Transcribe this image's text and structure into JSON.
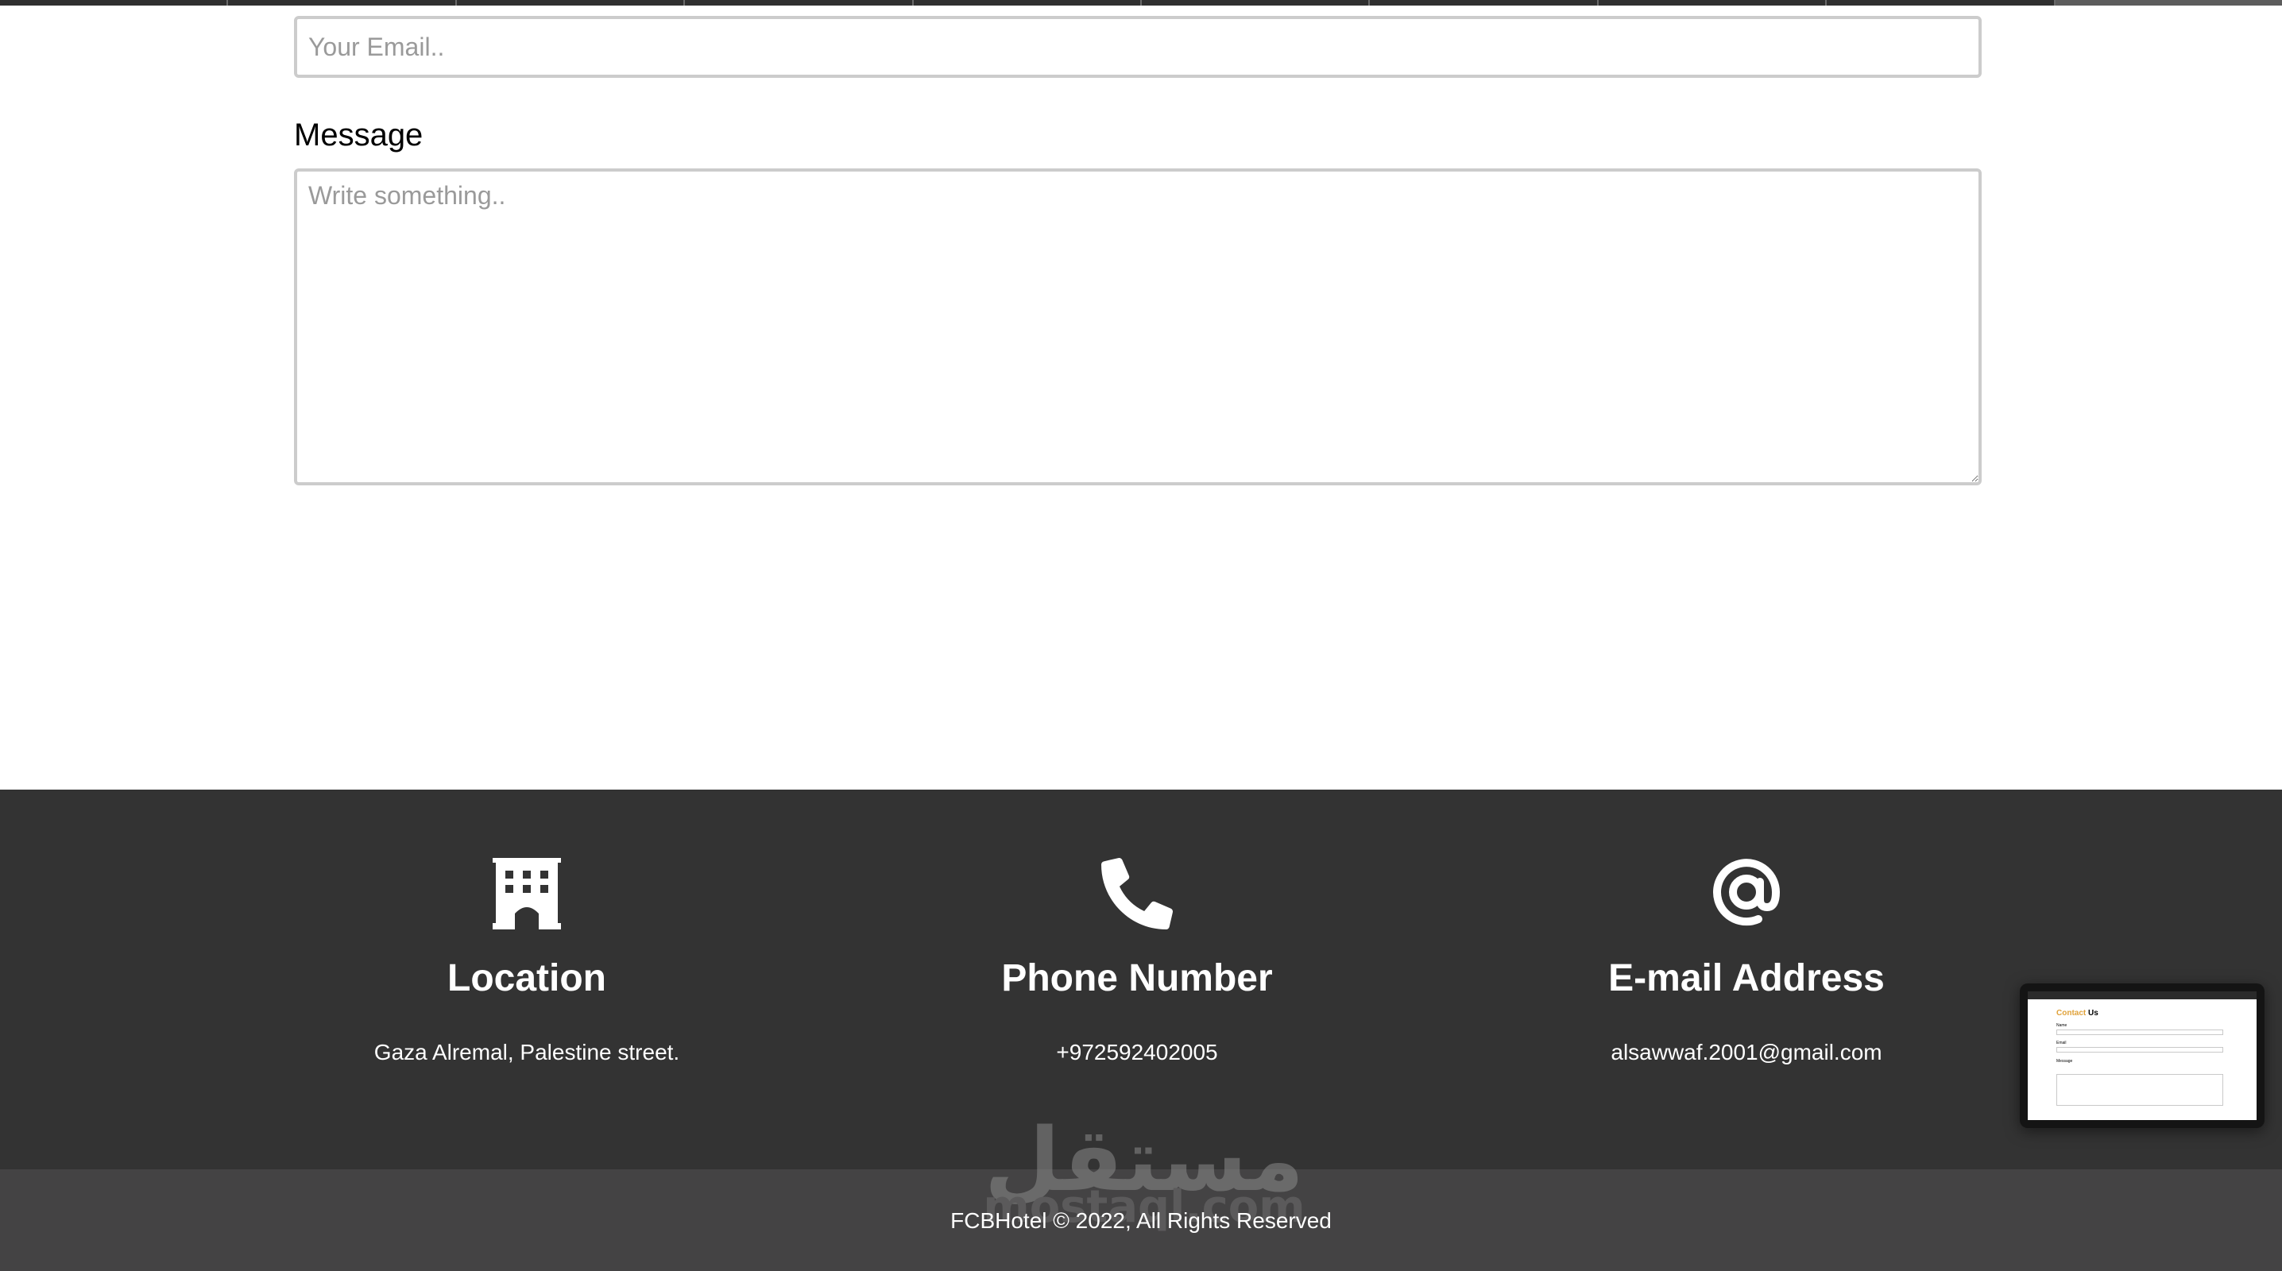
{
  "colors": {
    "footer_bg": "#333333",
    "copyright_bg": "#444344",
    "input_border": "#cccccc",
    "placeholder": "#9a9a9a",
    "text_light": "#ffffff"
  },
  "form": {
    "email_placeholder": "Your Email..",
    "message_label": "Message",
    "message_placeholder": "Write something.."
  },
  "footer": {
    "location": {
      "icon": "building-icon",
      "title": "Location",
      "text": "Gaza Alremal, Palestine street."
    },
    "phone": {
      "icon": "phone-icon",
      "title": "Phone Number",
      "text": "+972592402005"
    },
    "email": {
      "icon": "at-sign-icon",
      "title": "E-mail Address",
      "text": "alsawwaf.2001@gmail.com"
    },
    "copyright": "FCBHotel © 2022, All Rights Reserved"
  },
  "watermark": {
    "arabic": "مستقل",
    "latin": "mostaql.com"
  },
  "preview_thumbnail": {
    "title_accent": "Contact",
    "title_rest": " Us",
    "labels": [
      "Name",
      "Email",
      "Message"
    ]
  }
}
